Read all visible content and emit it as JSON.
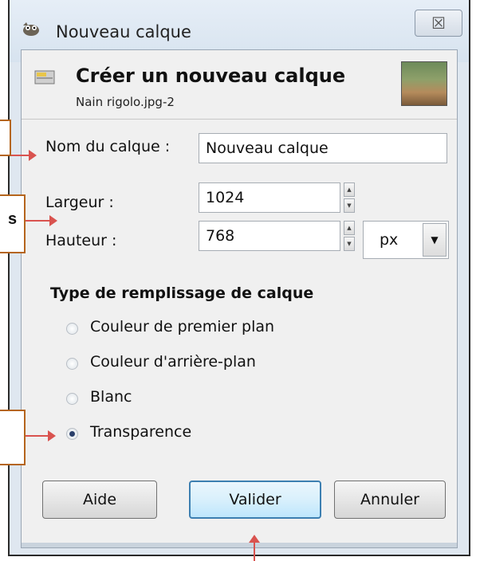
{
  "window": {
    "title": "Nouveau calque",
    "close_glyph": "☒"
  },
  "header": {
    "title": "Créer un nouveau calque",
    "subtitle": "Nain rigolo.jpg-2"
  },
  "fields": {
    "name_label": "Nom du calque :",
    "name_value": "Nouveau calque",
    "width_label": "Largeur :",
    "width_value": "1024",
    "height_label": "Hauteur :",
    "height_value": "768",
    "unit_value": "px"
  },
  "fill": {
    "section_title": "Type de remplissage de calque",
    "options": [
      {
        "label": "Couleur de premier plan",
        "checked": false
      },
      {
        "label": "Couleur d'arrière-plan",
        "checked": false
      },
      {
        "label": "Blanc",
        "checked": false
      },
      {
        "label": "Transparence",
        "checked": true
      }
    ]
  },
  "buttons": {
    "help": "Aide",
    "ok": "Valider",
    "cancel": "Annuler"
  },
  "annotations": {
    "callout_2_text": "s"
  },
  "colors": {
    "accent_border": "#3c7fb1",
    "annotation_arrow": "#d9534f",
    "callout_border": "#b5651d"
  }
}
